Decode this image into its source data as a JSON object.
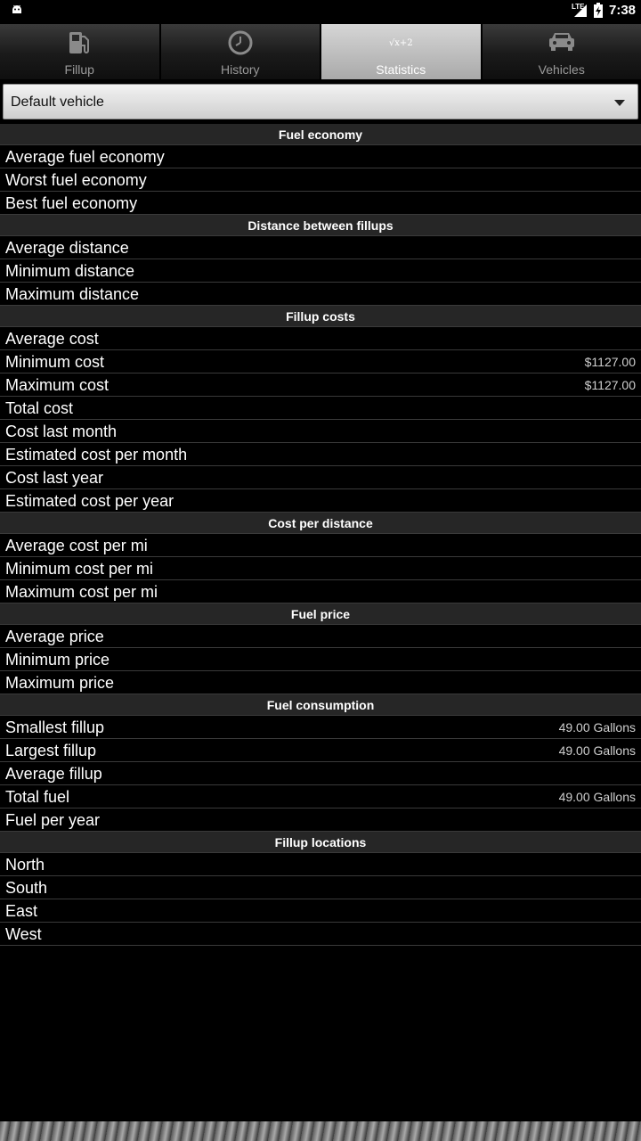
{
  "status_bar": {
    "network": "LTE",
    "time": "7:38"
  },
  "tabs": [
    {
      "label": "Fillup",
      "icon": "fuel-pump-icon",
      "active": false
    },
    {
      "label": "History",
      "icon": "clock-icon",
      "active": false
    },
    {
      "label": "Statistics",
      "icon": "formula-icon",
      "icon_text": "√x+2",
      "active": true
    },
    {
      "label": "Vehicles",
      "icon": "car-icon",
      "active": false
    }
  ],
  "vehicle_select": {
    "value": "Default vehicle"
  },
  "sections": [
    {
      "title": "Fuel economy",
      "rows": [
        {
          "label": "Average fuel economy",
          "value": ""
        },
        {
          "label": "Worst fuel economy",
          "value": ""
        },
        {
          "label": "Best fuel economy",
          "value": ""
        }
      ]
    },
    {
      "title": "Distance between fillups",
      "rows": [
        {
          "label": "Average distance",
          "value": ""
        },
        {
          "label": "Minimum distance",
          "value": ""
        },
        {
          "label": "Maximum distance",
          "value": ""
        }
      ]
    },
    {
      "title": "Fillup costs",
      "rows": [
        {
          "label": "Average cost",
          "value": ""
        },
        {
          "label": "Minimum cost",
          "value": "$1127.00"
        },
        {
          "label": "Maximum cost",
          "value": "$1127.00"
        },
        {
          "label": "Total cost",
          "value": ""
        },
        {
          "label": "Cost last month",
          "value": ""
        },
        {
          "label": "Estimated cost per month",
          "value": ""
        },
        {
          "label": "Cost last year",
          "value": ""
        },
        {
          "label": "Estimated cost per year",
          "value": ""
        }
      ]
    },
    {
      "title": "Cost per distance",
      "rows": [
        {
          "label": "Average cost per mi",
          "value": ""
        },
        {
          "label": "Minimum cost per mi",
          "value": ""
        },
        {
          "label": "Maximum cost per mi",
          "value": ""
        }
      ]
    },
    {
      "title": "Fuel price",
      "rows": [
        {
          "label": "Average price",
          "value": ""
        },
        {
          "label": "Minimum price",
          "value": ""
        },
        {
          "label": "Maximum price",
          "value": ""
        }
      ]
    },
    {
      "title": "Fuel consumption",
      "rows": [
        {
          "label": "Smallest fillup",
          "value": "49.00 Gallons"
        },
        {
          "label": "Largest fillup",
          "value": "49.00 Gallons"
        },
        {
          "label": "Average fillup",
          "value": ""
        },
        {
          "label": "Total fuel",
          "value": "49.00 Gallons"
        },
        {
          "label": "Fuel per year",
          "value": ""
        }
      ]
    },
    {
      "title": "Fillup locations",
      "rows": [
        {
          "label": "North",
          "value": ""
        },
        {
          "label": "South",
          "value": ""
        },
        {
          "label": "East",
          "value": ""
        },
        {
          "label": "West",
          "value": ""
        }
      ]
    }
  ]
}
